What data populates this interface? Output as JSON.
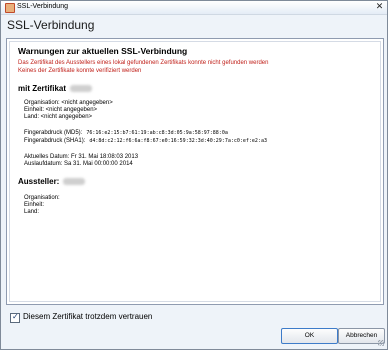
{
  "window": {
    "title": "SSL-Verbindung",
    "close_glyph": "✕"
  },
  "heading": "SSL-Verbindung",
  "warnings": {
    "title": "Warnungen zur aktuellen SSL-Verbindung",
    "lines": [
      "Das Zertifikat des Ausstellers eines lokal gefundenen Zertifikats konnte nicht gefunden werden",
      "Keines der Zertifikate konnte verifiziert werden"
    ]
  },
  "certificate": {
    "title": "mit Zertifikat",
    "organisation": "Organisation: <nicht angegeben>",
    "unit": "Einheit: <nicht angegeben>",
    "country": "Land: <nicht angegeben>",
    "md5_label": "Fingerabdruck (MD5):",
    "md5_value": "76:16:e2:15:b7:61:19:ab:c8:3d:05:9a:58:97:88:0a",
    "sha1_label": "Fingerabdruck (SHA1):",
    "sha1_value": "d4:8d:c2:12:f6:6a:f8:67:e0:16:59:32:3d:40:29:7a:c0:ef:e2:a3",
    "current_date": "Aktuelles Datum: Fr 31. Mai 18:08:03 2013",
    "expiry_date": "Auslaufdatum: Sa 31. Mai 00:00:00 2014"
  },
  "issuer": {
    "title": "Aussteller:",
    "organisation": "Organisation:",
    "unit": "Einheit:",
    "country": "Land:"
  },
  "trust_checkbox": {
    "label": "Diesem Zertifikat trotzdem vertrauen",
    "checked": true
  },
  "buttons": {
    "ok": "OK",
    "cancel": "Abbrechen"
  }
}
